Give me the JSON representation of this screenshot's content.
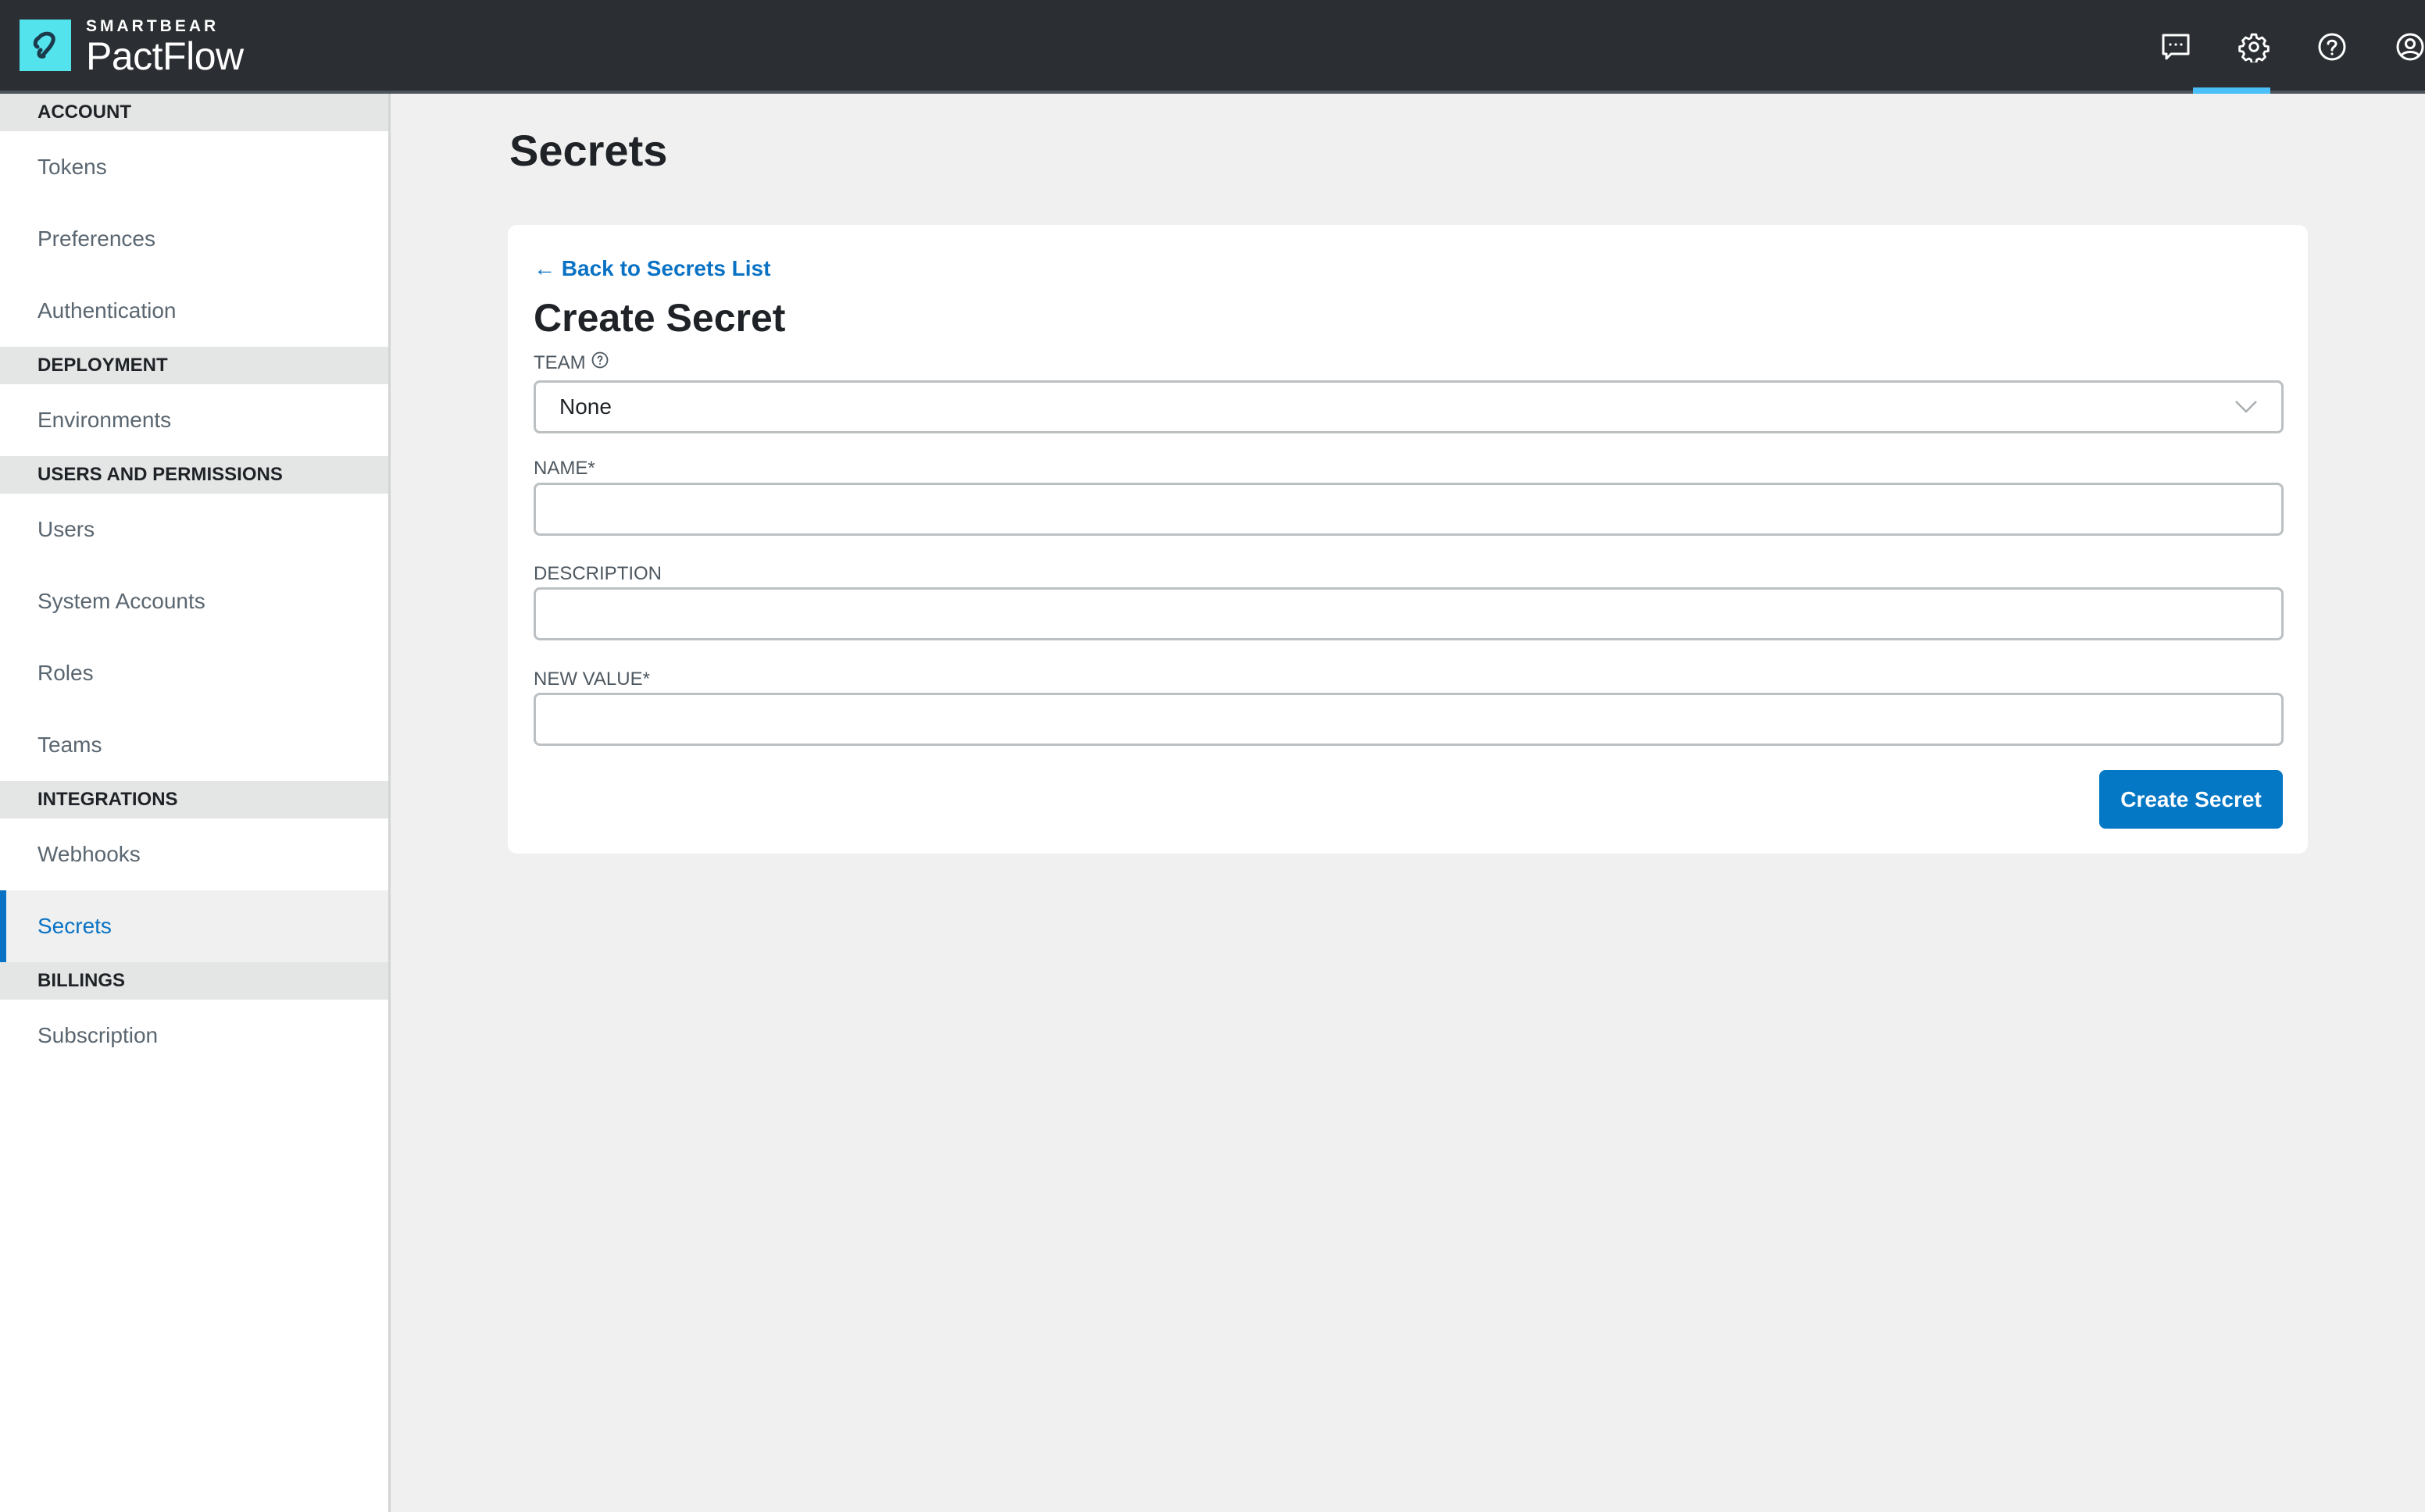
{
  "header": {
    "brand_small": "SMARTBEAR",
    "brand_name": "PactFlow",
    "icons": [
      {
        "name": "chat-icon",
        "active": false
      },
      {
        "name": "gear-icon",
        "active": true
      },
      {
        "name": "help-icon",
        "active": false
      },
      {
        "name": "user-icon",
        "active": false
      }
    ],
    "accent_color": "#4bbff7"
  },
  "sidebar": {
    "sections": [
      {
        "title": "ACCOUNT",
        "items": [
          "Tokens",
          "Preferences",
          "Authentication"
        ]
      },
      {
        "title": "DEPLOYMENT",
        "items": [
          "Environments"
        ]
      },
      {
        "title": "USERS AND PERMISSIONS",
        "items": [
          "Users",
          "System Accounts",
          "Roles",
          "Teams"
        ]
      },
      {
        "title": "INTEGRATIONS",
        "items": [
          "Webhooks",
          "Secrets"
        ]
      },
      {
        "title": "BILLINGS",
        "items": [
          "Subscription"
        ]
      }
    ],
    "active_item": "Secrets",
    "active_color": "#0a72c4"
  },
  "main": {
    "page_title": "Secrets",
    "card": {
      "back_link": "← Back to Secrets List",
      "title": "Create Secret",
      "fields": {
        "team": {
          "label": "TEAM",
          "value": "None",
          "has_help_icon": true
        },
        "name": {
          "label": "NAME*",
          "value": "",
          "placeholder": ""
        },
        "description": {
          "label": "DESCRIPTION",
          "value": "",
          "placeholder": ""
        },
        "new_value": {
          "label": "NEW VALUE*",
          "value": "",
          "placeholder": ""
        }
      },
      "submit_label": "Create Secret",
      "submit_color": "#0477c5"
    }
  }
}
